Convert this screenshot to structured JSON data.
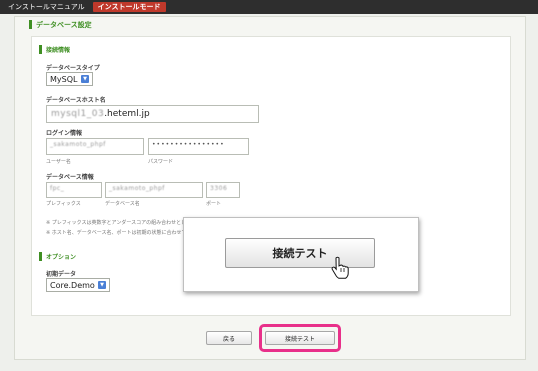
{
  "topbar": {
    "manual": "インストールマニュアル",
    "mode": "インストールモード"
  },
  "page": {
    "title": "データベース設定"
  },
  "connection": {
    "heading": "接続情報",
    "db_type_label": "データベースタイプ",
    "db_type_value": "MySQL",
    "host_label": "データベースホスト名",
    "host_value_blur": "mysql1_03",
    "host_value": ".heteml.jp",
    "login_label": "ログイン情報",
    "user_value": "_sakamoto_phpf",
    "password_value": "••••••••••••••••",
    "user_caption": "ユーザー名",
    "password_caption": "パスワード",
    "dbinfo_label": "データベース情報",
    "prefix_value": "fpc_",
    "dbname_value": "_sakamoto_phpf",
    "port_value": "3306",
    "prefix_caption": "プレフィックス",
    "dbname_caption": "データベース名",
    "port_caption": "ポート",
    "note1": "※ プレフィックスは英数字とアンダースコアの組み合わせとし末尾",
    "note2": "※ ホスト名、データベース名、ポートは初期の状態に合わせて値を"
  },
  "options": {
    "heading": "オプション",
    "initial_label": "初期データ",
    "initial_value": "Core.Demo"
  },
  "buttons": {
    "back": "戻る",
    "test": "接続テスト"
  },
  "callout": {
    "button": "接続テスト"
  }
}
